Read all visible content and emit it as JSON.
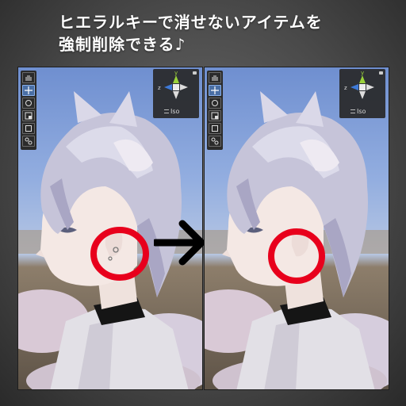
{
  "title": {
    "line1": "ヒエラルキーで消せないアイテムを",
    "line2": "強制削除できる♪"
  },
  "panels": [
    {
      "gizmo": {
        "axis_label": "z",
        "axis_y": "y",
        "view_mode": "Iso"
      }
    },
    {
      "gizmo": {
        "axis_label": "z",
        "axis_y": "y",
        "view_mode": "Iso"
      }
    }
  ],
  "toolbar_tools": [
    "hand-tool",
    "move-tool",
    "rotate-tool",
    "scale-tool",
    "rect-tool",
    "transform-tool"
  ],
  "colors": {
    "highlight_circle": "#e8001c",
    "arrow": "#000000",
    "sky_top": "#6f8fd0",
    "ground": "#5e5347",
    "gizmo_y": "#9ad23b",
    "gizmo_z": "#3e7ad8"
  }
}
